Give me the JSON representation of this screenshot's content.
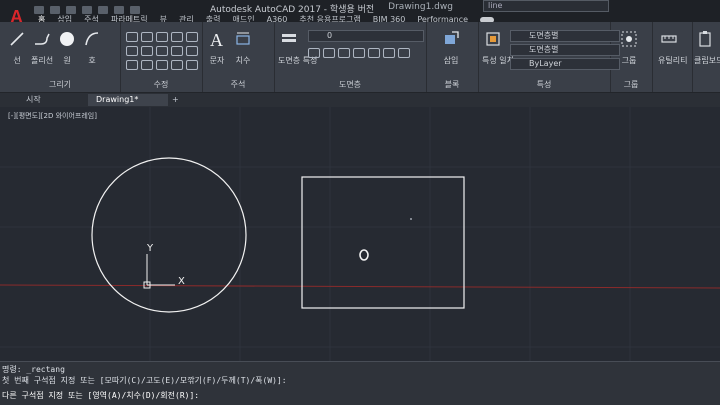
{
  "title_bar": {
    "app_title": "Autodesk AutoCAD 2017 - 학생용 버전",
    "file_name": "Drawing1.dwg",
    "search_text": "line"
  },
  "ribbon_tabs": [
    "홈",
    "삽입",
    "주석",
    "파라메트릭",
    "뷰",
    "관리",
    "출력",
    "애드인",
    "A360",
    "추천 응용프로그램",
    "BIM 360",
    "Performance"
  ],
  "draw_panel": {
    "title": "그리기",
    "tools": [
      "선",
      "폴리선",
      "원",
      "호"
    ]
  },
  "modify_panel": {
    "title": "수정"
  },
  "annotation_panel": {
    "title": "주석",
    "tools": [
      "문자",
      "치수"
    ]
  },
  "layers_panel": {
    "title": "도면층",
    "layer_props_label": "도면층 특성",
    "current_layer": "0"
  },
  "block_panel": {
    "title": "블록",
    "insert_label": "삽입"
  },
  "properties_panel": {
    "title": "특성",
    "match_label": "특성 일치",
    "color_value": "도면층별",
    "linetype_value": "도면층별",
    "lineweight_value": "ByLayer"
  },
  "groups_panel": {
    "title": "그룹",
    "group_label": "그룹"
  },
  "utilities_panel": {
    "utilities_label": "유틸리티"
  },
  "clipboard_panel": {
    "clipboard_label": "클립보드"
  },
  "doc_tabs": {
    "start_label": "시작",
    "drawing_label": "Drawing1*",
    "add_label": "+"
  },
  "viewport": {
    "label": "[-][평면도][2D 와이어프레임]",
    "ucs_x": "X",
    "ucs_y": "Y"
  },
  "command_line": {
    "line1": "명령: _rectang",
    "line2": "첫 번째 구석점 지정 또는 [모따기(C)/고도(E)/모깎기(F)/두께(T)/폭(W)]:",
    "line3": "다른 구석점 지정 또는 [영역(A)/치수(D)/회전(R)]:"
  },
  "colors": {
    "canvas": "#262a32",
    "ribbon": "#3a3f48",
    "accent": "#d8262b",
    "drawing": "#f2f2f2",
    "axis_red": "#8a2b2b"
  }
}
